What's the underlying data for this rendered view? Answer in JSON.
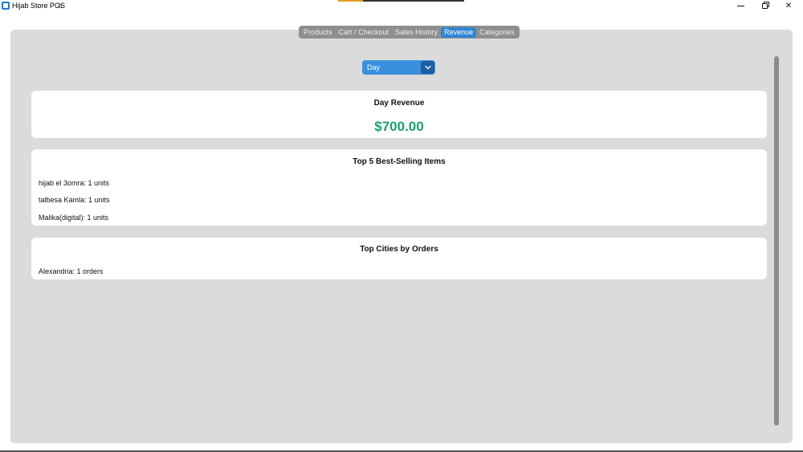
{
  "window": {
    "title": "Hijab Store POS",
    "home_glyph": "⌂",
    "close_glyph": "✕"
  },
  "tabs": [
    {
      "label": "Products",
      "active": false
    },
    {
      "label": "Cart / Checkout",
      "active": false
    },
    {
      "label": "Sales History",
      "active": false
    },
    {
      "label": "Revenue",
      "active": true
    },
    {
      "label": "Categories",
      "active": false
    }
  ],
  "period_select": {
    "value": "Day",
    "icon": "chevron-down-icon"
  },
  "revenue": {
    "title": "Day Revenue",
    "amount": "$700.00"
  },
  "best_sellers": {
    "title": "Top 5 Best-Selling Items",
    "items": [
      "hijab el 3omra: 1 units",
      "talbesa Kamla: 1 units",
      "Malika(digital): 1 units"
    ]
  },
  "top_cities": {
    "title": "Top Cities by Orders",
    "items": [
      "Alexandria: 1 orders"
    ]
  },
  "colors": {
    "accent": "#2f86d6",
    "revenue_green": "#1aa36b",
    "frame_bg": "#dbdbdb"
  }
}
